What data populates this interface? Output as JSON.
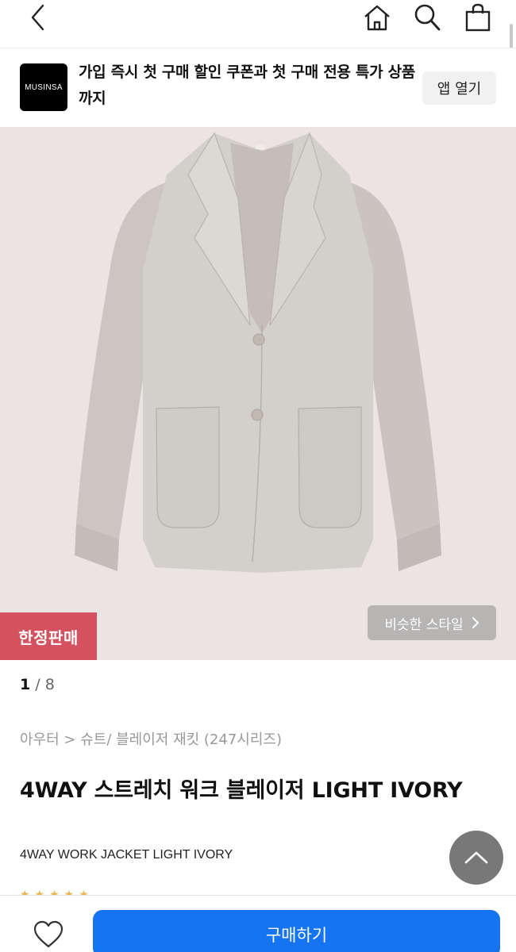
{
  "nav": {
    "back_icon": "chevron-left-icon",
    "home_icon": "home-icon",
    "search_icon": "search-icon",
    "cart_icon": "shopping-bag-icon"
  },
  "banner": {
    "logo_text": "MUSINSA",
    "promo_text": "가입 즉시 첫 구매 할인 쿠폰과 첫 구매 전용 특가 상품 까지",
    "open_app_label": "앱 열기"
  },
  "product": {
    "limited_badge": "한정판매",
    "similar_style_label": "비슷한 스타일",
    "image_current": "1",
    "image_separator": "/",
    "image_total": "8",
    "breadcrumb": "아우터 > 슈트/ 블레이저 재킷 (247시리즈)",
    "title": "4WAY 스트레치 워크 블레이저 LIGHT IVORY",
    "subtitle": "4WAY WORK JACKET LIGHT IVORY",
    "rating_stars": "★★★★★",
    "image_background": "#eae4e3",
    "jacket_color": "#cfcbc6"
  },
  "bottom_bar": {
    "like_icon": "heart-outline-icon",
    "buy_label": "구매하기",
    "buy_color": "#1774f0"
  },
  "badge_color": "#d4525f"
}
